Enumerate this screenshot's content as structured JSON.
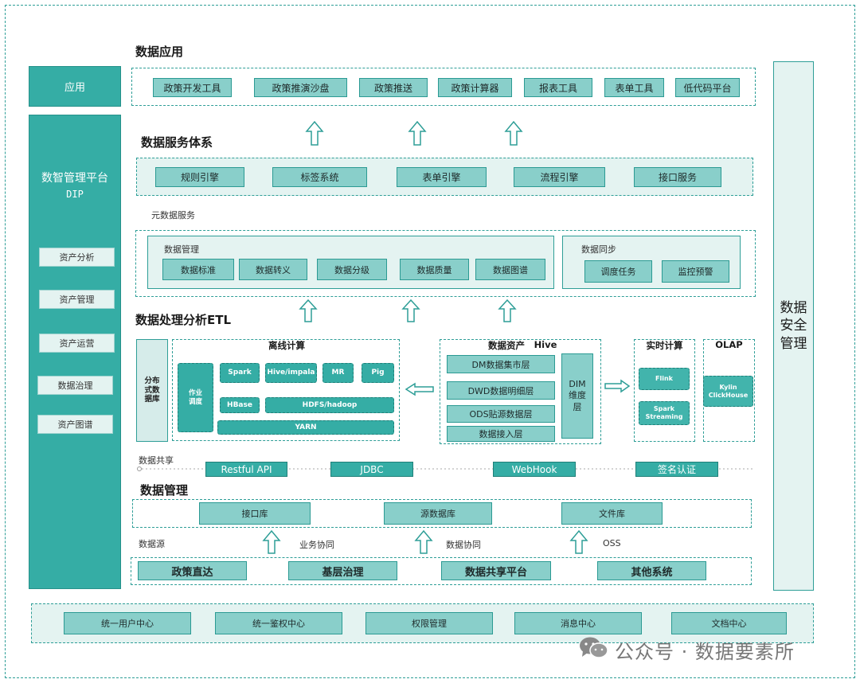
{
  "left_panel": {
    "app_label": "应用",
    "platform_title": "数智管理平台",
    "platform_sub": "DIP",
    "items": [
      "资产分析",
      "资产管理",
      "资产运营",
      "数据治理",
      "资产图谱"
    ]
  },
  "right_panel": {
    "label": "数据安全管理"
  },
  "data_app": {
    "title": "数据应用",
    "items": [
      "政策开发工具",
      "政策推演沙盘",
      "政策推送",
      "政策计算器",
      "报表工具",
      "表单工具",
      "低代码平台"
    ]
  },
  "data_service": {
    "title": "数据服务体系",
    "items": [
      "规则引擎",
      "标签系统",
      "表单引擎",
      "流程引擎",
      "接口服务"
    ]
  },
  "meta_service": {
    "title": "元数据服务",
    "mgmt_title": "数据管理",
    "mgmt_items": [
      "数据标准",
      "数据转义",
      "数据分级",
      "数据质量",
      "数据图谱"
    ],
    "sync_title": "数据同步",
    "sync_items": [
      "调度任务",
      "监控预警"
    ]
  },
  "etl": {
    "title": "数据处理分析ETL",
    "distributed_db": "分布式数据库",
    "offline": {
      "title": "离线计算",
      "scheduler": "作业调度",
      "spark": "Spark",
      "hive_impala": "Hive/impala",
      "mr": "MR",
      "pig": "Pig",
      "hbase": "HBase",
      "hdfs": "HDFS/hadoop",
      "yarn": "YARN"
    },
    "assets": {
      "title": "数据资产",
      "hive": "Hive",
      "layers": [
        "DM数据集市层",
        "DWD数据明细层",
        "ODS贴源数据层",
        "数据接入层"
      ],
      "dim": "DIM维度层"
    },
    "realtime": {
      "title": "实时计算",
      "flink": "Flink",
      "spark_streaming": "Spark Streaming"
    },
    "olap": {
      "title": "OLAP",
      "kylin": "Kylin ClickHouse"
    }
  },
  "data_share": {
    "title": "数据共享",
    "items": [
      "Restful API",
      "JDBC",
      "WebHook",
      "签名认证"
    ]
  },
  "data_mgmt": {
    "title": "数据管理",
    "items": [
      "接口库",
      "源数据库",
      "文件库"
    ]
  },
  "data_source": {
    "title": "数据源",
    "labels": [
      "业务协同",
      "数据协同",
      "OSS"
    ],
    "items": [
      "政策直达",
      "基层治理",
      "数据共享平台",
      "其他系统"
    ]
  },
  "bottom_bar": {
    "items": [
      "统一用户中心",
      "统一鉴权中心",
      "权限管理",
      "消息中心",
      "文档中心"
    ]
  },
  "watermark": {
    "text": "公众号 · 数据要素所"
  },
  "colors": {
    "teal": "#35ada5",
    "chip": "#89cfca",
    "border": "#2e9e97",
    "panel_bg": "#e4f3f1"
  }
}
